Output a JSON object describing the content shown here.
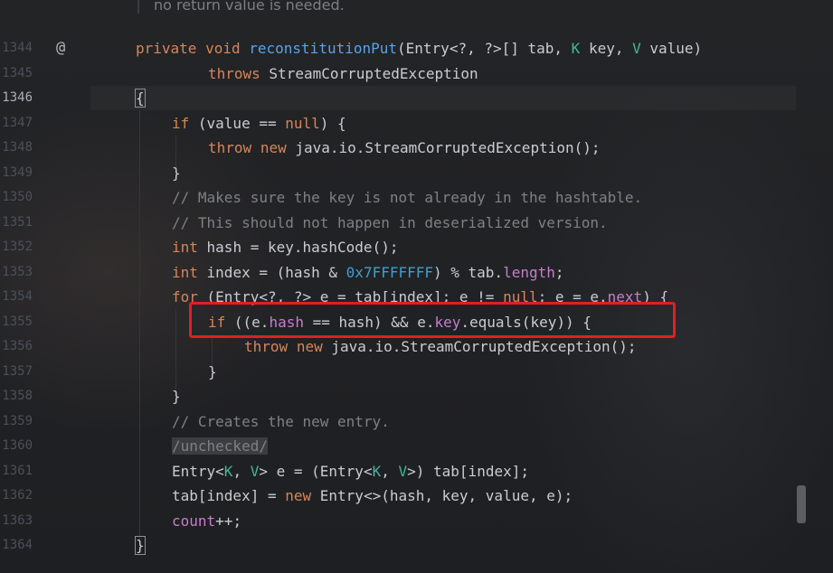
{
  "doc_comment": "no return value is needed.",
  "gutter": {
    "line_numbers": [
      "1344",
      "1345",
      "1346",
      "1347",
      "1348",
      "1349",
      "1350",
      "1351",
      "1352",
      "1353",
      "1354",
      "1355",
      "1356",
      "1357",
      "1358",
      "1359",
      "1360",
      "1361",
      "1362",
      "1363",
      "1364"
    ],
    "active_line": "1346",
    "override_marker": "@"
  },
  "code": {
    "l1344": {
      "kw1": "private",
      "kw2": "void",
      "fn": "reconstitutionPut",
      "a": "(Entry<?, ?>[] tab, ",
      "k": "K",
      "b": " key, ",
      "v": "V",
      "c": " value)"
    },
    "l1345": {
      "kw": "throws",
      "rest": " StreamCorruptedException"
    },
    "l1346": {
      "brace": "{"
    },
    "l1347": {
      "kw": "if",
      "a": " (value == ",
      "nul": "null",
      "b": ") {"
    },
    "l1348": {
      "kw1": "throw",
      "kw2": "new",
      "rest": " java.io.StreamCorruptedException();"
    },
    "l1349": {
      "brace": "}"
    },
    "l1350": {
      "comment": "// Makes sure the key is not already in the hashtable."
    },
    "l1351": {
      "comment": "// This should not happen in deserialized version."
    },
    "l1352": {
      "kw": "int",
      "rest": " hash = key.hashCode();"
    },
    "l1353": {
      "kw": "int",
      "a": " index = (hash & ",
      "num": "0x7FFFFFFF",
      "b": ") % tab.",
      "fd": "length",
      "c": ";"
    },
    "l1354": {
      "kw": "for",
      "a": " (Entry<?, ?> e = tab[index]; e != ",
      "nul": "null",
      "b": "; e = e.",
      "fd": "next",
      "c": ") {"
    },
    "l1355": {
      "kw": "if",
      "a": " ((e.",
      "fd1": "hash",
      "b": " == hash) && e.",
      "fd2": "key",
      "c": ".equals(key)) {"
    },
    "l1356": {
      "kw1": "throw",
      "kw2": "new",
      "rest": " java.io.StreamCorruptedException();"
    },
    "l1357": {
      "brace": "}"
    },
    "l1358": {
      "brace": "}"
    },
    "l1359": {
      "comment": "// Creates the new entry."
    },
    "l1360": {
      "unchecked": "/unchecked/"
    },
    "l1361": {
      "a": "Entry<",
      "k1": "K",
      "b": ", ",
      "v1": "V",
      "c": "> e = (Entry<",
      "k2": "K",
      "d": ", ",
      "v2": "V",
      "e": ">) tab[index];"
    },
    "l1362": {
      "a": "tab[index] = ",
      "kw": "new",
      "b": " Entry<>(hash, key, value, e);"
    },
    "l1363": {
      "fd": "count",
      "a": "++;"
    },
    "l1364": {
      "brace": "}"
    }
  },
  "colors": {
    "highlight_box": "#e02020",
    "keyword": "#d6865a",
    "function": "#5aa3e8",
    "type_param": "#3fb99d",
    "field": "#c77dcf",
    "comment": "#7d8087"
  }
}
